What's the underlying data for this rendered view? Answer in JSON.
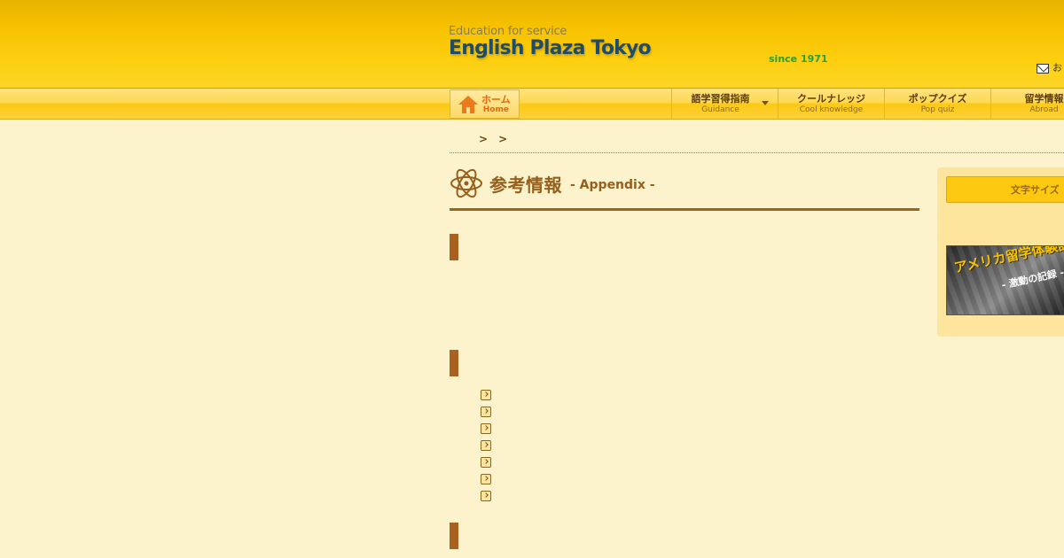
{
  "header": {
    "tagline": "Education for service",
    "site_name": "English Plaza Tokyo",
    "since": "since 1971",
    "contact_label": "お"
  },
  "nav": {
    "home": {
      "jp": "ホーム",
      "en": "Home"
    },
    "items": [
      {
        "jp": "語学習得指南",
        "en": "Guidance",
        "has_dropdown": true
      },
      {
        "jp": "クールナレッジ",
        "en": "Cool knowledge"
      },
      {
        "jp": "ポップクイズ",
        "en": "Pop quiz"
      },
      {
        "jp": "留学情報",
        "en": "Abroad"
      }
    ]
  },
  "breadcrumb": {
    "separators": [
      ">",
      ">"
    ]
  },
  "page": {
    "title_jp": "参考情報",
    "title_en": "- Appendix -"
  },
  "sidebar": {
    "font_size_label": "文字サイズ",
    "banner": {
      "title": "アメリカ留学体験記",
      "subtitle": "- 激動の記録 -"
    }
  },
  "colors": {
    "header_yellow": "#f7c100",
    "page_bg": "#fcf2cc",
    "accent_brown": "#a8611e",
    "logo_blue": "#1f4c6a",
    "since_green": "#2aa033"
  }
}
